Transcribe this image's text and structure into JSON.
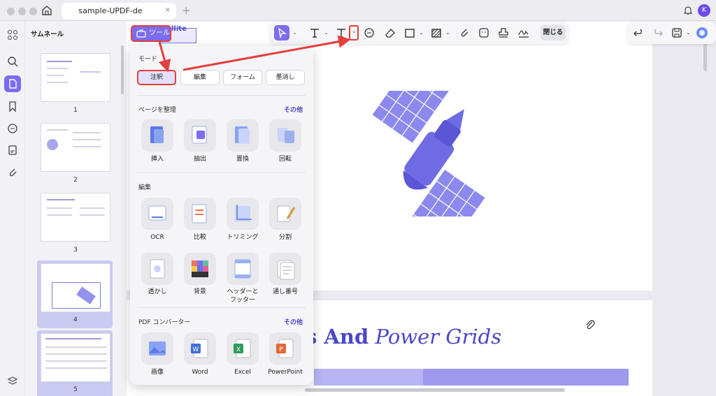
{
  "titlebar": {
    "tab_title": "sample-UPDF-de",
    "tab_close": "×",
    "new_tab": "+",
    "avatar_initial": "K"
  },
  "sidebar": {
    "title": "サムネール",
    "pages": [
      "1",
      "2",
      "3",
      "4",
      "5"
    ]
  },
  "toolbar": {
    "tool_button_label": "ツール",
    "close_label": "閉じる"
  },
  "popup": {
    "mode_title": "モード",
    "modes": [
      "注釈",
      "編集",
      "フォーム",
      "墨消し"
    ],
    "organize": {
      "title": "ページを整理",
      "more": "その他",
      "items": [
        "挿入",
        "抽出",
        "置換",
        "回転"
      ]
    },
    "edit": {
      "title": "編集",
      "items": [
        "OCR",
        "比較",
        "トリミング",
        "分割",
        "透かし",
        "背景",
        "ヘッダーと",
        "フッター",
        "通し番号"
      ]
    },
    "converter": {
      "title": "PDF コンバーター",
      "more": "その他",
      "items": [
        "画像",
        "Word",
        "Excel",
        "PowerPoint"
      ]
    }
  },
  "document": {
    "snippet_text": "llite",
    "heading_bold": "s And",
    "heading_italic": " Power Grids"
  },
  "colors": {
    "accent": "#7b6cf0",
    "highlight": "#e53e3e",
    "heading": "#4a47c9"
  }
}
